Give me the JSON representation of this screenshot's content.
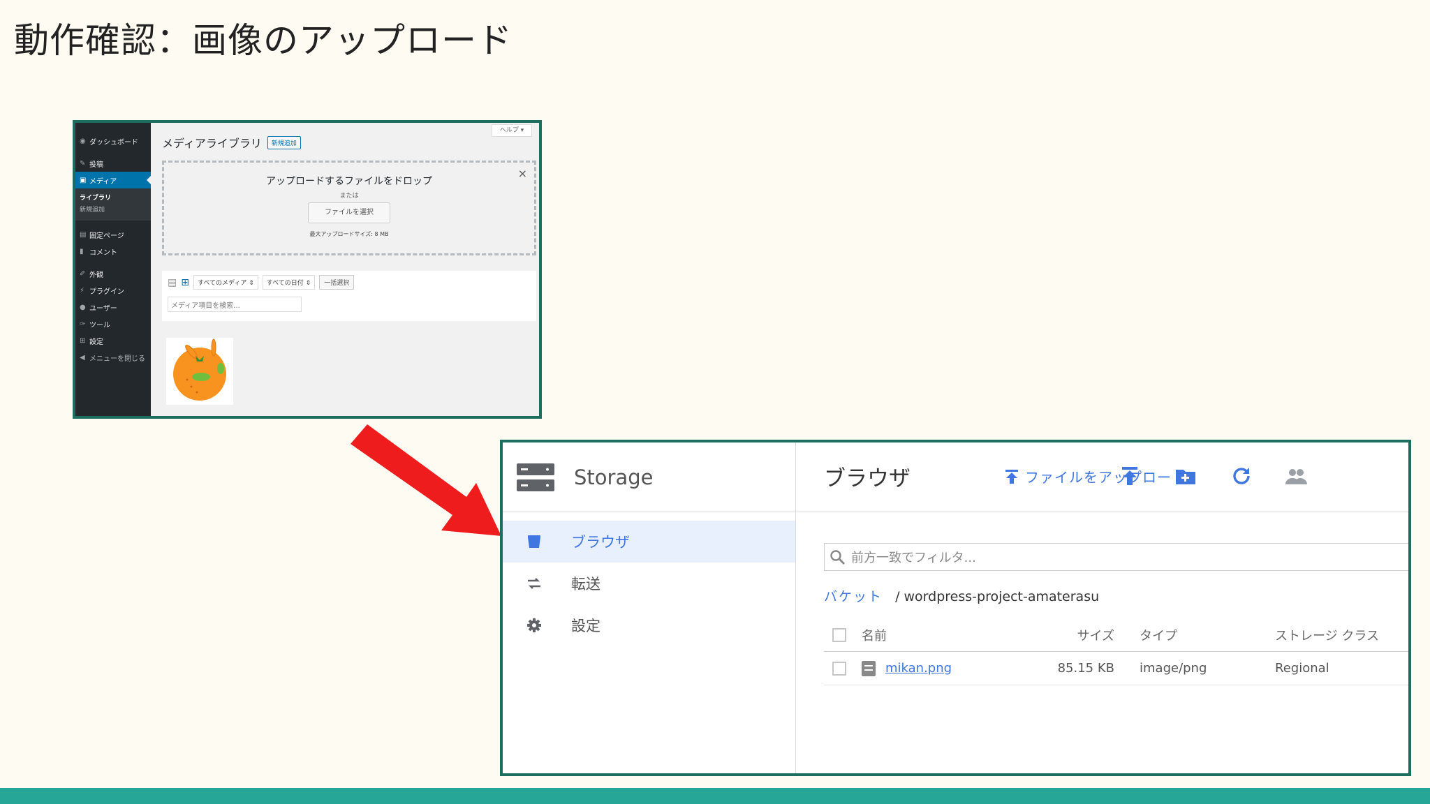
{
  "slide": {
    "title": "動作確認：画像のアップロード"
  },
  "wordpress": {
    "help_label": "ヘルプ ▾",
    "sidebar": [
      {
        "label": "ダッシュボード",
        "icon": "dashboard-icon"
      },
      {
        "label": "投稿",
        "icon": "pin-icon"
      },
      {
        "label": "メディア",
        "icon": "media-icon",
        "active": true
      },
      {
        "label": "固定ページ",
        "icon": "page-icon"
      },
      {
        "label": "コメント",
        "icon": "comment-icon"
      },
      {
        "label": "外観",
        "icon": "brush-icon"
      },
      {
        "label": "プラグイン",
        "icon": "plugin-icon"
      },
      {
        "label": "ユーザー",
        "icon": "user-icon"
      },
      {
        "label": "ツール",
        "icon": "wrench-icon"
      },
      {
        "label": "設定",
        "icon": "settings-icon"
      },
      {
        "label": "メニューを閉じる",
        "icon": "collapse-icon"
      }
    ],
    "submenu": [
      "ライブラリ",
      "新規追加"
    ],
    "page_title": "メディアライブラリ",
    "add_new_label": "新規追加",
    "dropzone": {
      "text": "アップロードするファイルをドロップ",
      "or": "または",
      "button": "ファイルを選択",
      "max_size": "最大アップロードサイズ: 8 MB",
      "close": "×"
    },
    "filters": {
      "media_type": "すべてのメディア ⇕",
      "date": "すべての日付 ⇕",
      "bulk_select": "一括選択",
      "search_placeholder": "メディア項目を検索..."
    }
  },
  "storage": {
    "product_name": "Storage",
    "nav": [
      {
        "label": "ブラウザ",
        "icon": "bucket-icon",
        "active": true
      },
      {
        "label": "転送",
        "icon": "transfer-icon"
      },
      {
        "label": "設定",
        "icon": "gear-icon"
      }
    ],
    "heading": "ブラウザ",
    "upload_label": "ファイルをアップロード",
    "filter_placeholder": "前方一致でフィルタ...",
    "breadcrumb": {
      "root": "バケット",
      "separator": "/",
      "bucket": "wordpress-project-amaterasu"
    },
    "table": {
      "columns": [
        "名前",
        "サイズ",
        "タイプ",
        "ストレージ クラス"
      ],
      "rows": [
        {
          "name": "mikan.png",
          "size": "85.15 KB",
          "type": "image/png",
          "storage_class": "Regional"
        }
      ]
    },
    "accent_color": "#3f76e0"
  },
  "colors": {
    "slide_background": "#fefcf2",
    "frame_border": "#1e6e60",
    "bottom_bar": "#26a696",
    "arrow": "#ee1c1c"
  }
}
